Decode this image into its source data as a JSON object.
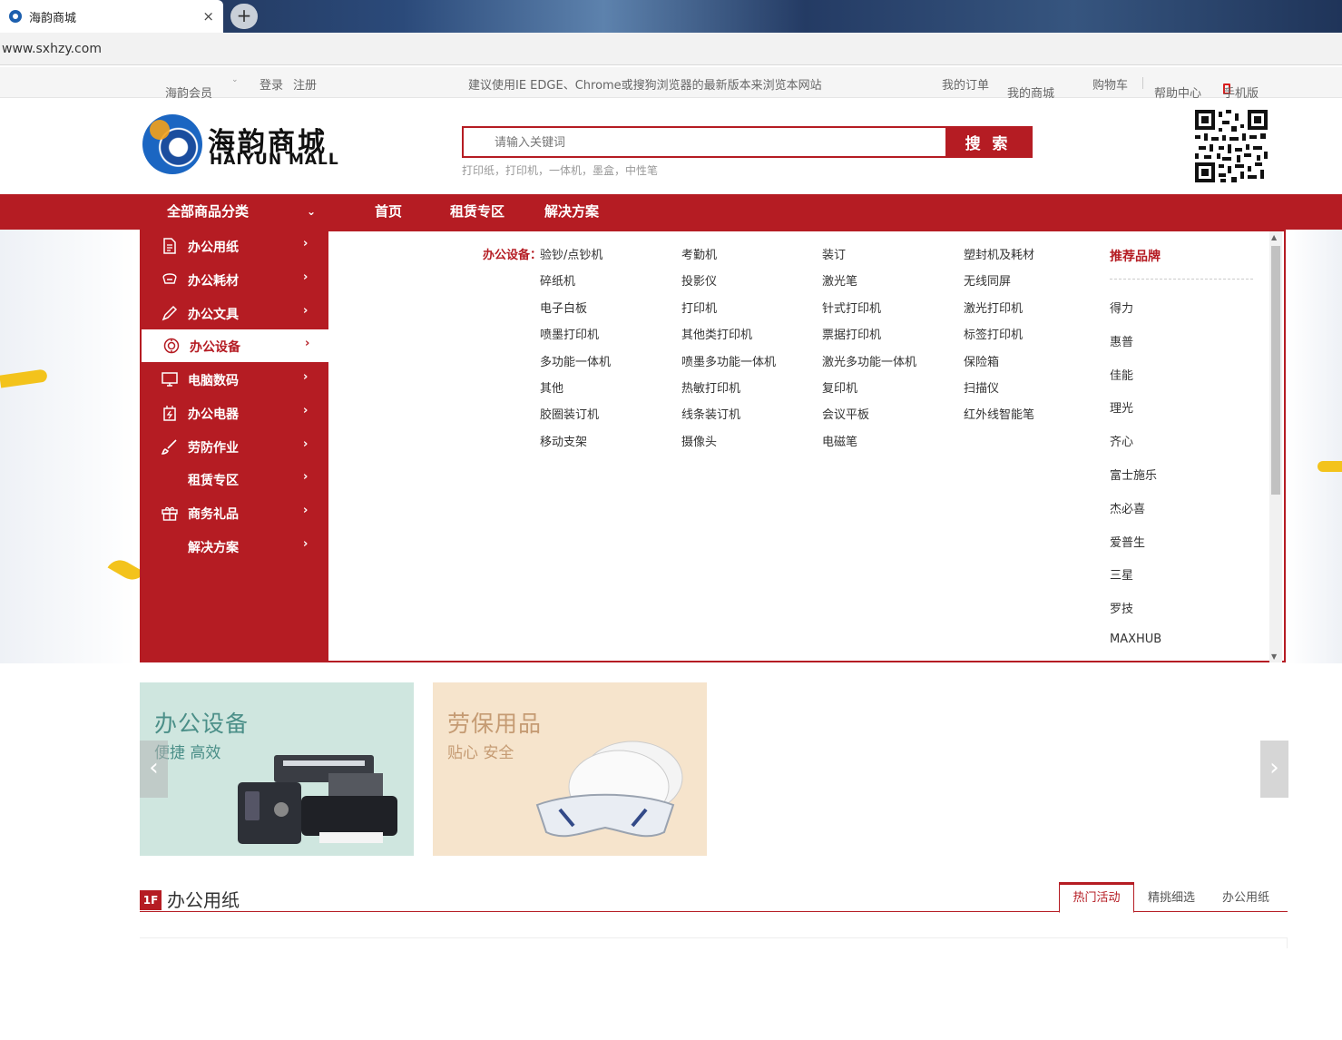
{
  "browser": {
    "tab_title": "海韵商城",
    "close_glyph": "×",
    "new_tab_glyph": "+",
    "url": "www.sxhzy.com"
  },
  "topbar": {
    "member": "海韵会员",
    "member_caret": "⌄",
    "login": "登录",
    "register": "注册",
    "notice": "建议使用IE EDGE、Chrome或搜狗浏览器的最新版本来浏览本网站",
    "my_orders": "我的订单",
    "my_mall": "我的商城",
    "cart": "购物车",
    "help": "帮助中心",
    "mobile": "手机版",
    "caret": "⌄"
  },
  "header": {
    "logo_cn": "海韵商城",
    "logo_en": "HAIYUN MALL",
    "search_placeholder": "请输入关键词",
    "search_button": "搜 索",
    "hot_words": "打印纸，打印机，一体机，墨盒，中性笔"
  },
  "nav": {
    "all_categories": "全部商品分类",
    "chevron": "⌄",
    "links": [
      "首页",
      "租赁专区",
      "解决方案"
    ]
  },
  "sidebar": {
    "arrow": "›",
    "items": [
      {
        "label": "办公用纸",
        "icon": "document-icon"
      },
      {
        "label": "办公耗材",
        "icon": "consumables-icon"
      },
      {
        "label": "办公文具",
        "icon": "pen-icon"
      },
      {
        "label": "办公设备",
        "icon": "equipment-icon",
        "active": true
      },
      {
        "label": "电脑数码",
        "icon": "monitor-icon"
      },
      {
        "label": "办公电器",
        "icon": "appliance-icon"
      },
      {
        "label": "劳防作业",
        "icon": "brush-icon"
      },
      {
        "label": "租赁专区",
        "icon": ""
      },
      {
        "label": "商务礼品",
        "icon": "gift-icon"
      },
      {
        "label": "解决方案",
        "icon": ""
      }
    ]
  },
  "dropdown": {
    "category_label": "办公设备：",
    "items": [
      [
        "验钞/点钞机",
        "考勤机",
        "装订",
        "塑封机及耗材"
      ],
      [
        "碎纸机",
        "投影仪",
        "激光笔",
        "无线同屏"
      ],
      [
        "电子白板",
        "打印机",
        "针式打印机",
        "激光打印机"
      ],
      [
        "喷墨打印机",
        "其他类打印机",
        "票据打印机",
        "标签打印机"
      ],
      [
        "多功能一体机",
        "喷墨多功能一体机",
        "激光多功能一体机",
        "保险箱"
      ],
      [
        "其他",
        "热敏打印机",
        "复印机",
        "扫描仪"
      ],
      [
        "胶圈装订机",
        "线条装订机",
        "会议平板",
        "红外线智能笔"
      ],
      [
        "移动支架",
        "摄像头",
        "电磁笔",
        ""
      ]
    ],
    "brands_title": "推荐品牌",
    "brands": [
      "得力",
      "惠普",
      "佳能",
      "理光",
      "齐心",
      "富士施乐",
      "杰必喜",
      "爱普生",
      "三星",
      "罗技",
      "MAXHUB"
    ]
  },
  "promos": [
    {
      "title": "办公设备",
      "subtitle": "便捷 高效"
    },
    {
      "title": "劳保用品",
      "subtitle": "贴心 安全"
    }
  ],
  "slider": {
    "prev": "‹",
    "next": "›"
  },
  "floor": {
    "badge": "1F",
    "title": "办公用纸",
    "tabs": [
      "热门活动",
      "精挑细选",
      "办公用纸"
    ]
  },
  "colors": {
    "brand_red": "#b51c23",
    "text": "#333333"
  }
}
